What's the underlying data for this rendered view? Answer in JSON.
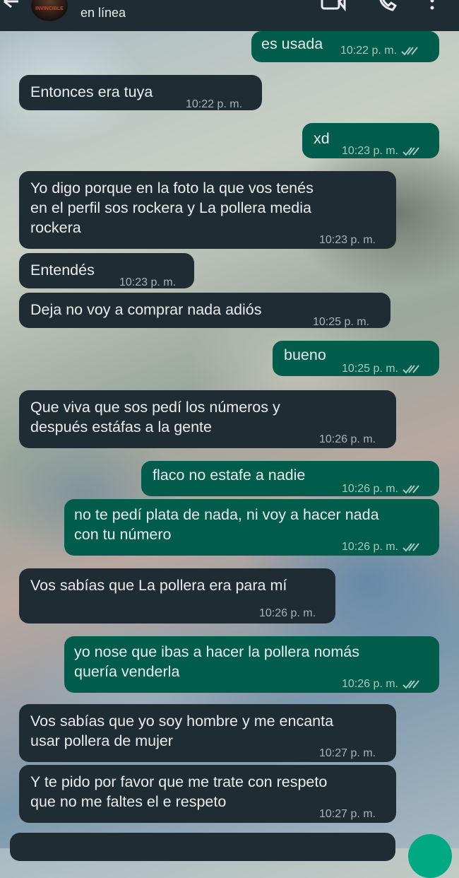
{
  "header": {
    "avatar_text": "INVINCIBLE",
    "status": "en línea"
  },
  "messages": [
    {
      "dir": "out",
      "lines": [
        "es usada"
      ],
      "time": "10:22 p. m."
    },
    {
      "dir": "in",
      "lines": [
        "Entonces era tuya"
      ],
      "time": "10:22 p. m."
    },
    {
      "dir": "out",
      "lines": [
        "xd"
      ],
      "time": "10:23 p. m."
    },
    {
      "dir": "in",
      "lines": [
        "Yo digo porque en la foto la que vos tenés",
        "en el perfil sos rockera y La pollera media",
        "rockera"
      ],
      "time": "10:23 p. m."
    },
    {
      "dir": "in",
      "lines": [
        "Entendés"
      ],
      "time": "10:23 p. m."
    },
    {
      "dir": "in",
      "lines": [
        "Deja no voy a comprar nada adiós"
      ],
      "time": "10:25 p. m."
    },
    {
      "dir": "out",
      "lines": [
        "bueno"
      ],
      "time": "10:25 p. m."
    },
    {
      "dir": "in",
      "lines": [
        "Que viva que sos pedí los números y",
        "después estáfas a la gente"
      ],
      "time": "10:26 p. m."
    },
    {
      "dir": "out",
      "lines": [
        "flaco no estafe a nadie"
      ],
      "time": "10:26 p. m."
    },
    {
      "dir": "out",
      "lines": [
        "no te pedí plata de nada, ni voy a hacer nada",
        "con tu número"
      ],
      "time": "10:26 p. m."
    },
    {
      "dir": "in",
      "lines": [
        "Vos sabías que La pollera era para mí"
      ],
      "time": "10:26 p. m."
    },
    {
      "dir": "out",
      "lines": [
        "yo nose que ibas a hacer la pollera nomás",
        "quería venderla"
      ],
      "time": "10:26 p. m."
    },
    {
      "dir": "in",
      "lines": [
        "Vos sabías que yo soy hombre y me encanta",
        "usar pollera de mujer"
      ],
      "time": "10:27 p. m."
    },
    {
      "dir": "in",
      "lines": [
        "Y te pido por favor que me trate con respeto",
        "que no me faltes el e respeto"
      ],
      "time": "10:27 p. m."
    }
  ],
  "colors": {
    "incoming": "#202c33",
    "outgoing": "#005c4b",
    "header": "#1f2c34",
    "accent": "#00a884"
  },
  "icons": [
    "back-arrow-icon",
    "video-call-icon",
    "voice-call-icon",
    "more-options-icon",
    "read-receipt-icon",
    "compose-icon"
  ]
}
